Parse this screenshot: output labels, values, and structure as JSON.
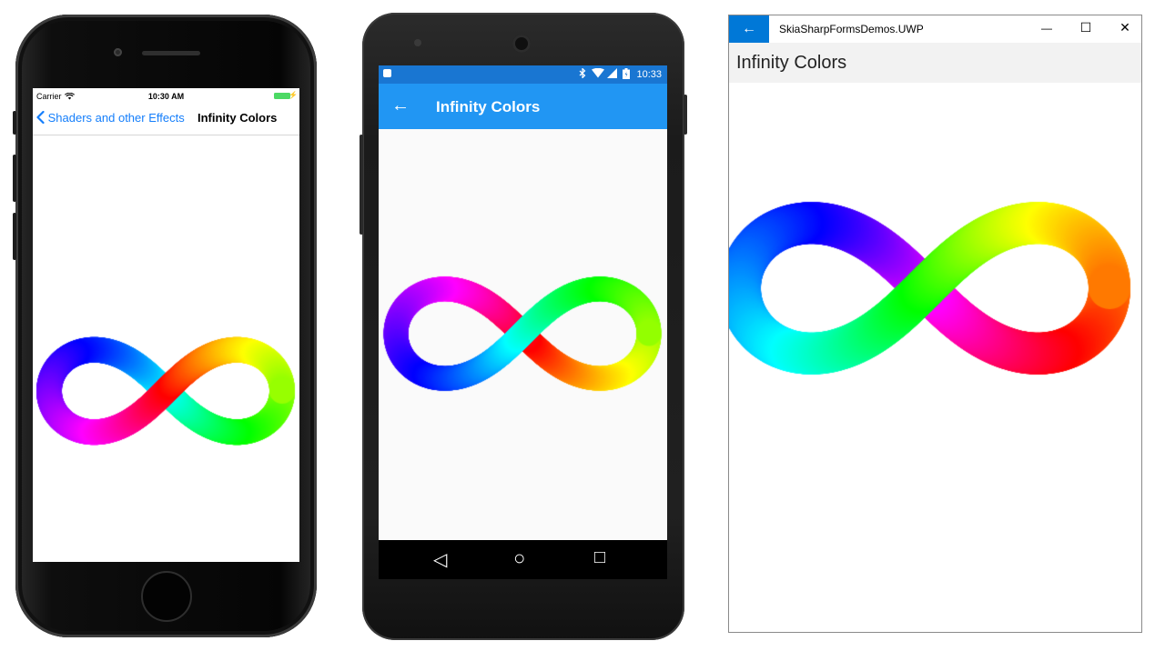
{
  "ios": {
    "carrier": "Carrier",
    "wifi_icon": "wifi-icon",
    "time": "10:30 AM",
    "charging_icon": "⚡",
    "back_label": "Shaders and other Effects",
    "title": "Infinity Colors"
  },
  "android": {
    "time": "10:33",
    "status_icons": "bluetooth-icon wifi-icon signal-icon battery-icon",
    "back_glyph": "←",
    "title": "Infinity Colors",
    "nav": {
      "back": "◁",
      "home": "○",
      "recents": "□"
    }
  },
  "uwp": {
    "app_title": "SkiaSharpFormsDemos.UWP",
    "back_glyph": "←",
    "minimize": "—",
    "maximize": "☐",
    "close": "✕",
    "header_title": "Infinity Colors"
  },
  "colors": {
    "ios_tint": "#147efb",
    "android_primary": "#2196f3",
    "android_status": "#1976d2",
    "uwp_accent": "#0078d7"
  }
}
